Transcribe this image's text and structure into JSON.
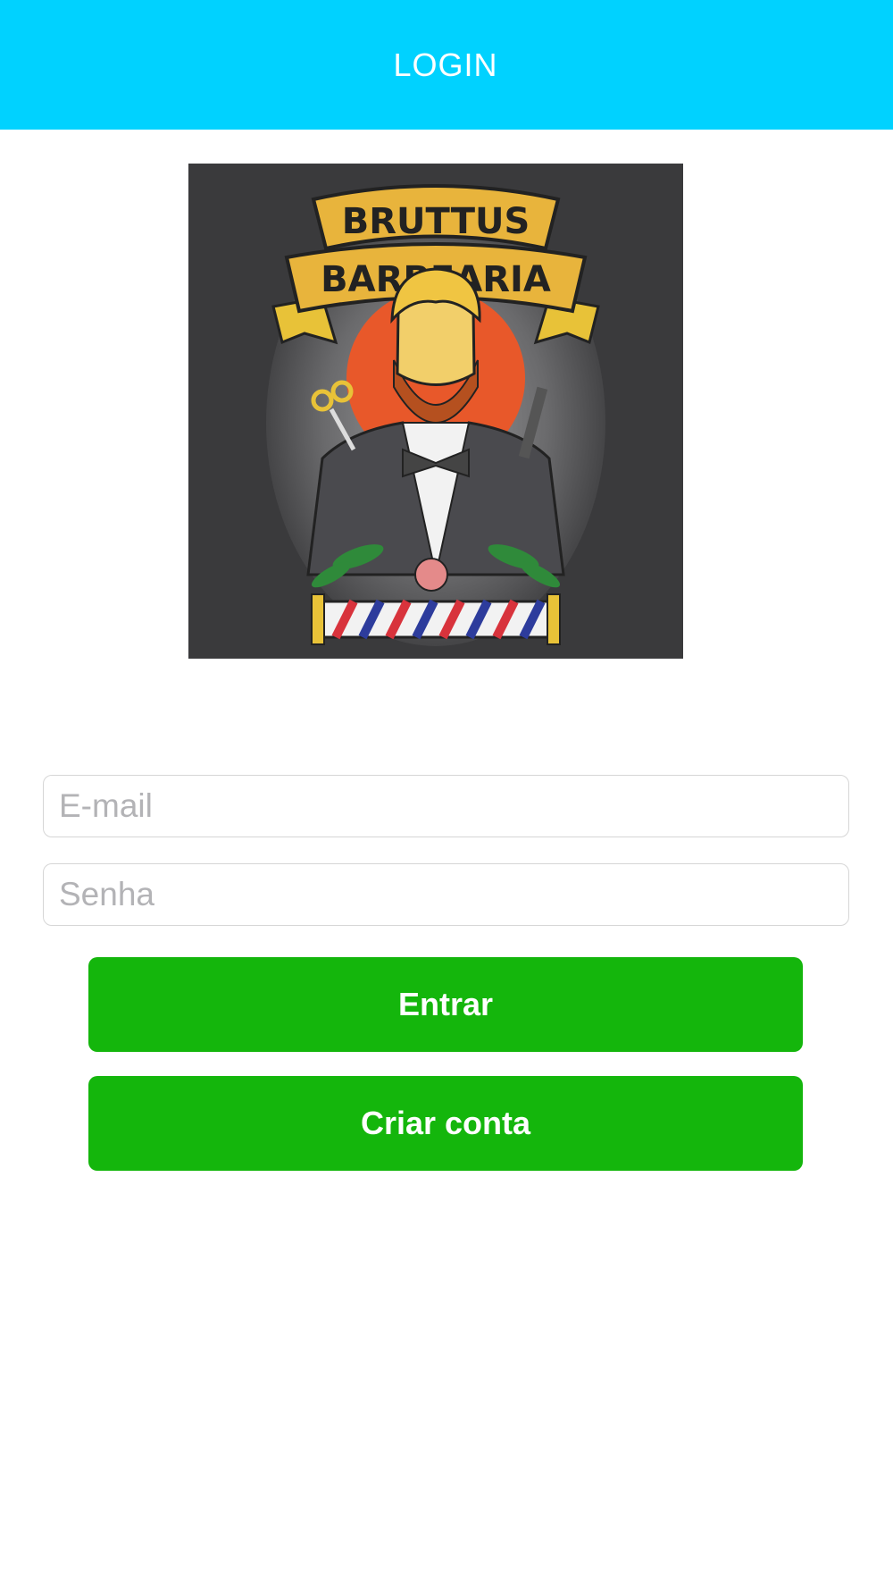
{
  "header": {
    "title": "LOGIN"
  },
  "logo": {
    "line1": "BRUTTUS",
    "line2": "BARBEARIA",
    "colors": {
      "background": "#3a3a3c",
      "banner": "#e8b43c",
      "sun": "#e8582a",
      "hair": "#f0c542",
      "beard": "#b5501f",
      "pole_red": "#d8333c",
      "pole_blue": "#2d3c9c",
      "leaf": "#2f8a3a"
    }
  },
  "form": {
    "email": {
      "value": "",
      "placeholder": "E-mail"
    },
    "password": {
      "value": "",
      "placeholder": "Senha"
    }
  },
  "buttons": {
    "login_label": "Entrar",
    "register_label": "Criar conta",
    "color": "#14b60c"
  },
  "theme": {
    "header_color": "#00d2ff"
  }
}
